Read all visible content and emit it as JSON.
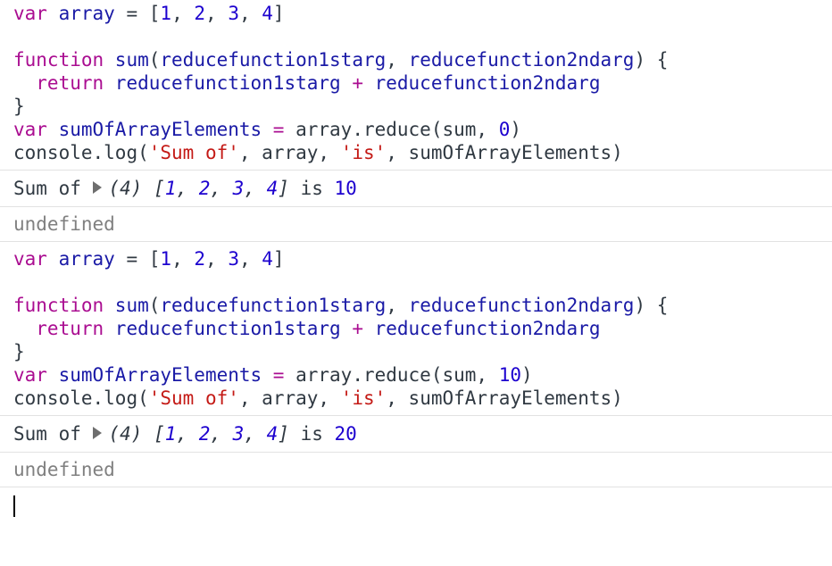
{
  "blocks": [
    {
      "lines": {
        "l1": [
          "var",
          " ",
          "array",
          " = ",
          "[",
          "1",
          ", ",
          "2",
          ", ",
          "3",
          ", ",
          "4",
          "]"
        ],
        "l3_a": "function",
        "l3_b": " sum",
        "l3_c": "(",
        "l3_d": "reducefunction1starg",
        "l3_e": ", ",
        "l3_f": "reducefunction2ndarg",
        "l3_g": ") {",
        "l4_a": "  return",
        "l4_b": " reducefunction1starg",
        "l4_c": " + ",
        "l4_d": "reducefunction2ndarg",
        "l5": "}",
        "l6_a": "var",
        "l6_b": " sumOfArrayElements",
        "l6_c": " = ",
        "l6_d": "array",
        "l6_e": ".reduce(sum, ",
        "l6_f": "0",
        "l6_g": ")",
        "l7_a": "console",
        "l7_b": ".log(",
        "l7_c": "'Sum of'",
        "l7_d": ", array, ",
        "l7_e": "'is'",
        "l7_f": ", sumOfArrayElements)"
      },
      "output": {
        "prefix": "Sum of ",
        "count": "(4)",
        "arr_open": " [",
        "n1": "1",
        "n2": "2",
        "n3": "3",
        "n4": "4",
        "arr_close": "]",
        "is": " is ",
        "result": "10"
      },
      "undefined": "undefined"
    },
    {
      "lines": {
        "l1": [
          "var",
          " ",
          "array",
          " = ",
          "[",
          "1",
          ", ",
          "2",
          ", ",
          "3",
          ", ",
          "4",
          "]"
        ],
        "l3_a": "function",
        "l3_b": " sum",
        "l3_c": "(",
        "l3_d": "reducefunction1starg",
        "l3_e": ", ",
        "l3_f": "reducefunction2ndarg",
        "l3_g": ") {",
        "l4_a": "  return",
        "l4_b": " reducefunction1starg",
        "l4_c": " + ",
        "l4_d": "reducefunction2ndarg",
        "l5": "}",
        "l6_a": "var",
        "l6_b": " sumOfArrayElements",
        "l6_c": " = ",
        "l6_d": "array",
        "l6_e": ".reduce(sum, ",
        "l6_f": "10",
        "l6_g": ")",
        "l7_a": "console",
        "l7_b": ".log(",
        "l7_c": "'Sum of'",
        "l7_d": ", array, ",
        "l7_e": "'is'",
        "l7_f": ", sumOfArrayElements)"
      },
      "output": {
        "prefix": "Sum of ",
        "count": "(4)",
        "arr_open": " [",
        "n1": "1",
        "n2": "2",
        "n3": "3",
        "n4": "4",
        "arr_close": "]",
        "is": " is ",
        "result": "20"
      },
      "undefined": "undefined"
    }
  ],
  "colors": {
    "keyword": "#881280",
    "number": "#1c00cf",
    "string": "#c41a16",
    "identifier": "#1a1aa6",
    "muted": "#808080"
  },
  "icons": {
    "expand": "disclosure-triangle-icon",
    "caret": "text-cursor-icon"
  }
}
